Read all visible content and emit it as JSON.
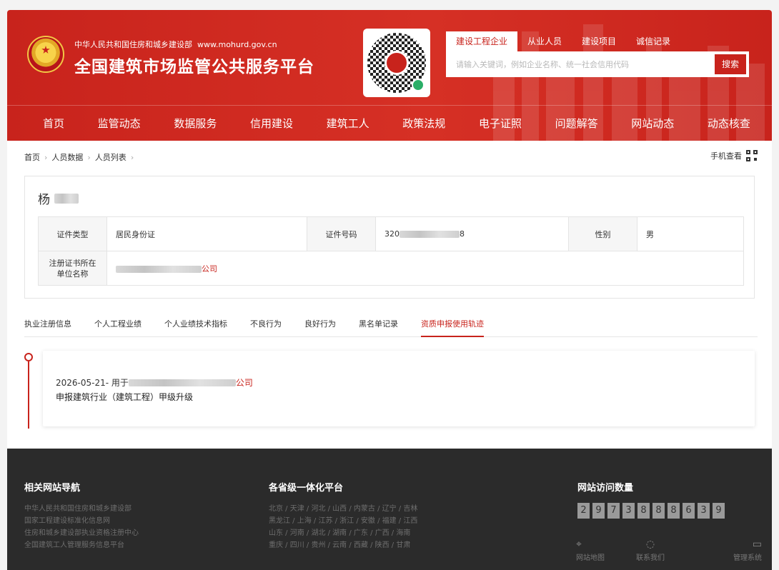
{
  "header": {
    "ministry": "中华人民共和国住房和城乡建设部",
    "url": "www.mohurd.gov.cn",
    "title": "全国建筑市场监管公共服务平台"
  },
  "search": {
    "tabs": [
      "建设工程企业",
      "从业人员",
      "建设项目",
      "诚信记录"
    ],
    "placeholder": "请输入关键词，例如企业名称、统一社会信用代码",
    "button": "搜索"
  },
  "nav": [
    "首页",
    "监管动态",
    "数据服务",
    "信用建设",
    "建筑工人",
    "政策法规",
    "电子证照",
    "问题解答",
    "网站动态",
    "动态核查"
  ],
  "breadcrumb": [
    "首页",
    "人员数据",
    "人员列表"
  ],
  "mobile_view": "手机查看",
  "person": {
    "surname": "杨",
    "id_type_label": "证件类型",
    "id_type": "居民身份证",
    "id_no_label": "证件号码",
    "id_no_prefix": "320",
    "id_no_suffix": "8",
    "gender_label": "性别",
    "gender": "男",
    "company_label_1": "注册证书所在",
    "company_label_2": "单位名称",
    "company_suffix": "公司"
  },
  "tabs": [
    "执业注册信息",
    "个人工程业绩",
    "个人业绩技术指标",
    "不良行为",
    "良好行为",
    "黑名单记录",
    "资质申报使用轨迹"
  ],
  "active_tab": 6,
  "timeline": {
    "date": "2026-05-21",
    "prefix": " - 用于",
    "company_suffix": "公司",
    "desc": "申报建筑行业（建筑工程）甲级升级"
  },
  "footer": {
    "nav_title": "相关网站导航",
    "nav_links": [
      "中华人民共和国住房和城乡建设部",
      "国家工程建设标准化信息网",
      "住房和城乡建设部执业资格注册中心",
      "全国建筑工人管理服务信息平台"
    ],
    "prov_title": "各省级一体化平台",
    "prov_lines": [
      "北京 / 天津 / 河北 / 山西 / 内蒙古 / 辽宁 / 吉林",
      "黑龙江 / 上海 / 江苏 / 浙江 / 安徽 / 福建 / 江西",
      "山东 / 河南 / 湖北 / 湖南 / 广东 / 广西 / 海南",
      "重庆 / 四川 / 贵州 / 云南 / 西藏 / 陕西 / 甘肃"
    ],
    "visits_title": "网站访问数量",
    "visits": [
      "2",
      "9",
      "7",
      "3",
      "8",
      "8",
      "8",
      "6",
      "3",
      "9"
    ],
    "icons": [
      {
        "label": "网站地图",
        "icon": "map-pin-icon"
      },
      {
        "label": "联系我们",
        "icon": "chat-icon"
      },
      {
        "label": "管理系统",
        "icon": "monitor-icon"
      }
    ]
  },
  "colors": {
    "brand_red": "#c8231c",
    "footer_bg": "#2b2b2b"
  }
}
